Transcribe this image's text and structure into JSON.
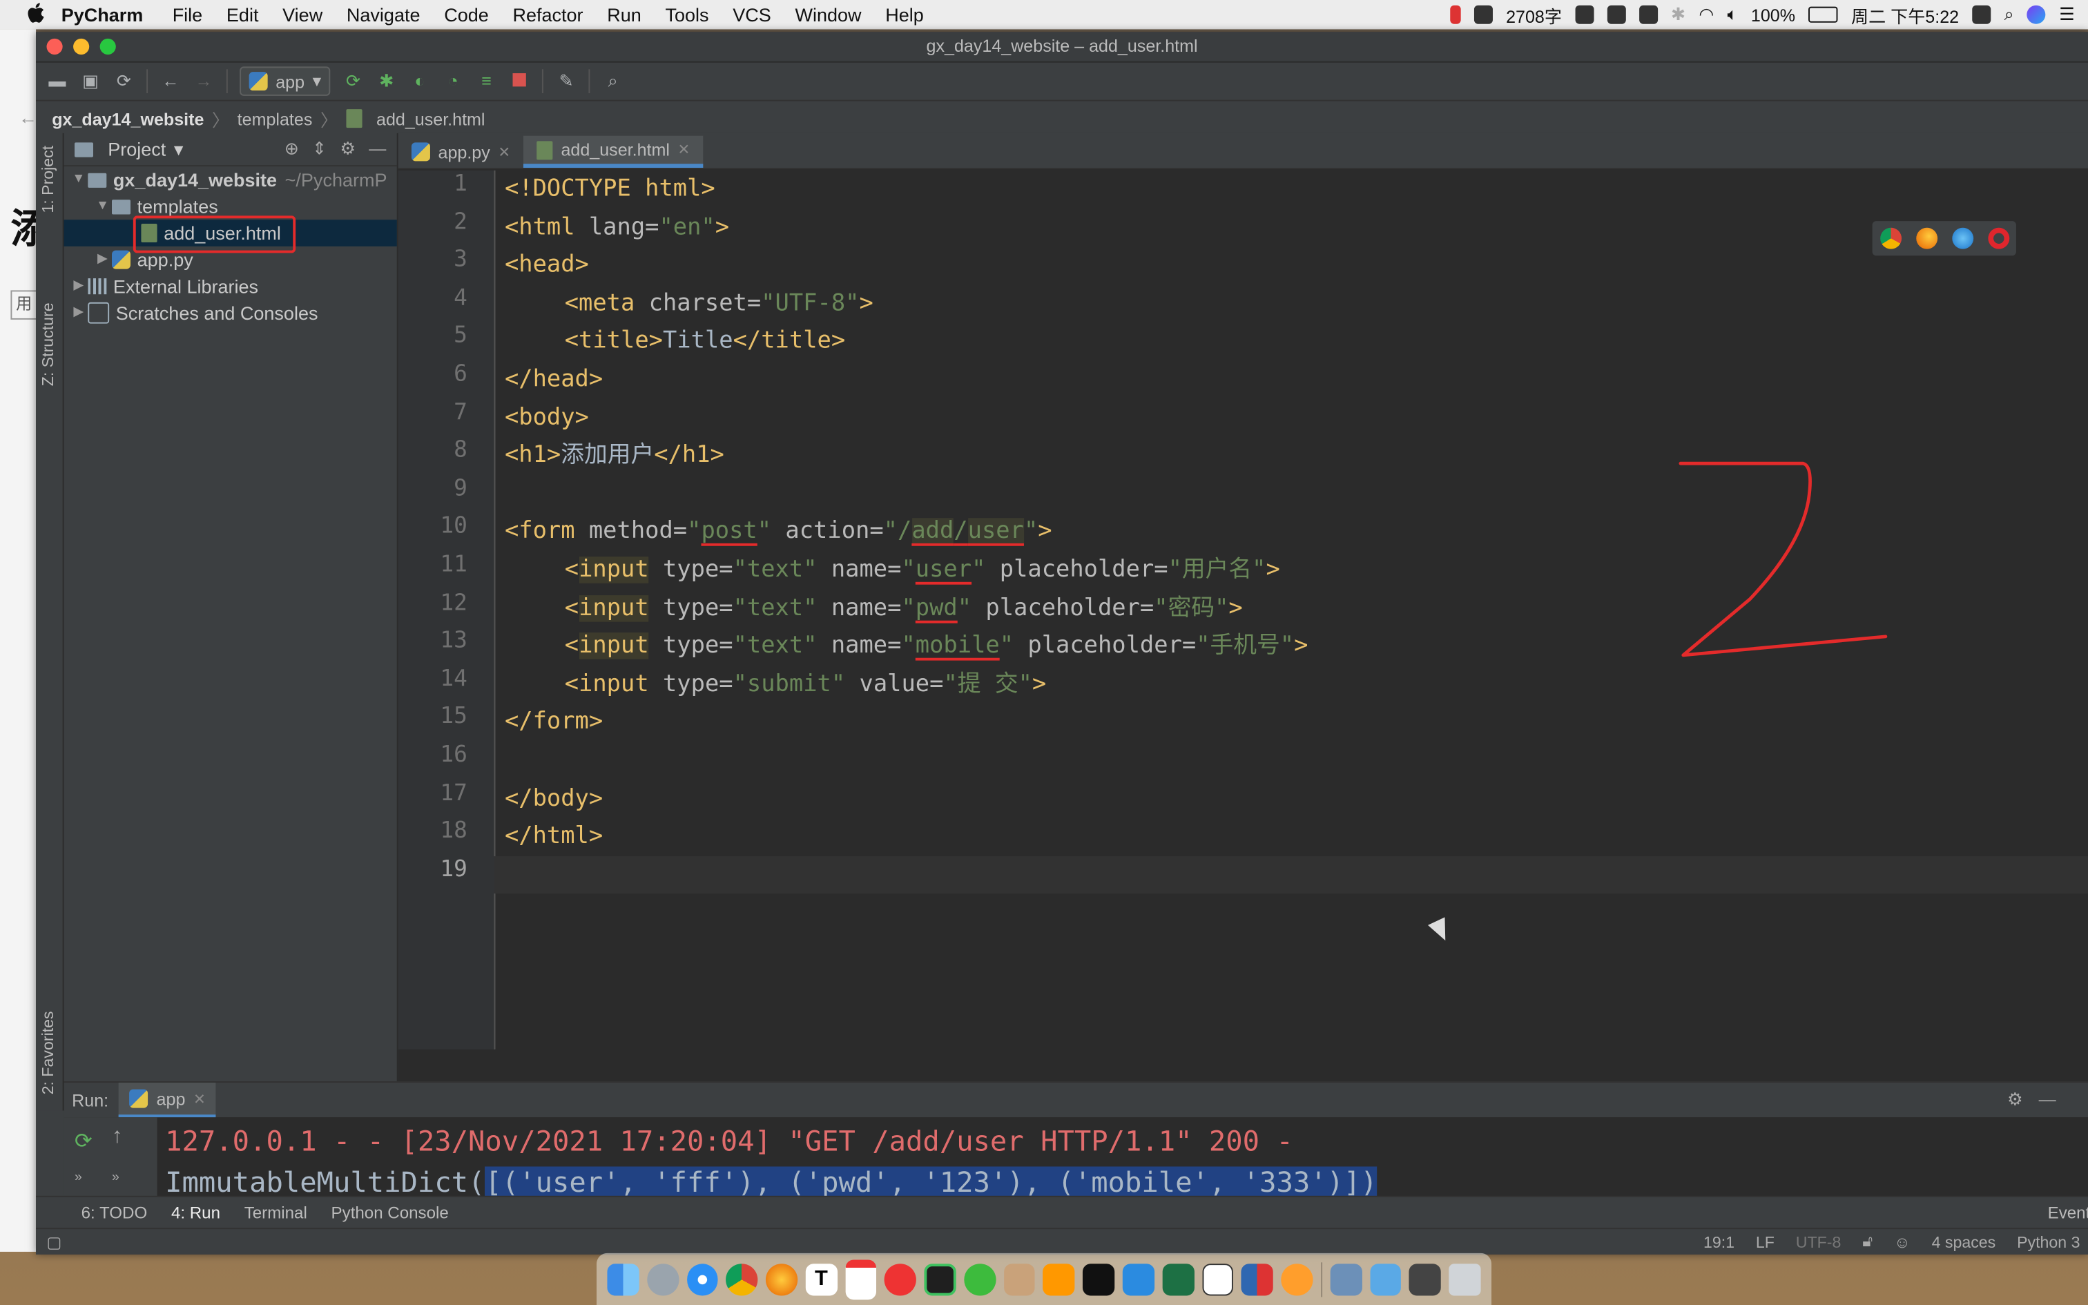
{
  "menubar": {
    "app_name": "PyCharm",
    "menus": [
      "File",
      "Edit",
      "View",
      "Navigate",
      "Code",
      "Refactor",
      "Run",
      "Tools",
      "VCS",
      "Window",
      "Help"
    ],
    "word_count": "2708字",
    "battery": "100%",
    "clock": "周二 下午5:22"
  },
  "background_window": {
    "big_char": "添",
    "small_char": "用"
  },
  "window": {
    "title": "gx_day14_website – add_user.html"
  },
  "toolbar": {
    "run_config": "app"
  },
  "breadcrumb": [
    "gx_day14_website",
    "templates",
    "add_user.html"
  ],
  "side_tabs": {
    "project": "1: Project",
    "structure": "Z: Structure",
    "favorites": "2: Favorites"
  },
  "project_panel": {
    "title": "Project",
    "root": "gx_day14_website",
    "root_path": "~/PycharmP",
    "folder_templates": "templates",
    "file_selected": "add_user.html",
    "file_app": "app.py",
    "external_libraries": "External Libraries",
    "scratches": "Scratches and Consoles"
  },
  "editor_tabs": [
    {
      "label": "app.py"
    },
    {
      "label": "add_user.html"
    }
  ],
  "code": {
    "line_numbers": [
      "1",
      "2",
      "3",
      "4",
      "5",
      "6",
      "7",
      "8",
      "9",
      "10",
      "11",
      "12",
      "13",
      "14",
      "15",
      "16",
      "17",
      "18",
      "19"
    ],
    "l1_doctype": "<!DOCTYPE html>",
    "l2_open": "<html ",
    "l2_attr": "lang=",
    "l2_val": "\"en\"",
    "l2_close": ">",
    "l3": "<head>",
    "l4_open": "<meta ",
    "l4_attr": "charset=",
    "l4_val": "\"UTF-8\"",
    "l4_close": ">",
    "l5_open": "<title>",
    "l5_text": "Title",
    "l5_close": "</title>",
    "l6": "</head>",
    "l7": "<body>",
    "l8_open": "<h1>",
    "l8_text": "添加用户",
    "l8_close": "</h1>",
    "l10_open": "<form ",
    "l10_attr1": "method=",
    "l10_q1": "\"",
    "l10_post": "post",
    "l10_q2": "\" ",
    "l10_attr2": "action=",
    "l10_path_a": "\"/",
    "l10_path_b": "add",
    "l10_path_c": "/",
    "l10_path_d": "user",
    "l10_path_e": "\"",
    "l10_close": ">",
    "input_tag_open": "<",
    "input_word": "input",
    "l11_rest_a": " type=",
    "l11_type": "\"text\"",
    "l11_rest_b": " name=",
    "l11_q": "\"",
    "l11_name": "user",
    "l11_q2": "\"",
    "l11_rest_c": " placeholder=",
    "l11_ph": "\"用户名\"",
    "l11_close": ">",
    "l12_rest_a": " type=",
    "l12_type": "\"text\"",
    "l12_rest_b": " name=",
    "l12_q": "\"",
    "l12_name": "pwd",
    "l12_q2": "\"",
    "l12_rest_c": " placeholder=",
    "l12_ph": "\"密码\"",
    "l12_close": ">",
    "l13_rest_a": " type=",
    "l13_type": "\"text\"",
    "l13_rest_b": " name=",
    "l13_q": "\"",
    "l13_name": "mobile",
    "l13_q2": "\"",
    "l13_rest_c": " placeholder=",
    "l13_ph": "\"手机号\"",
    "l13_close": ">",
    "l14_open": "<input ",
    "l14_attr1": "type=",
    "l14_val1": "\"submit\"",
    "l14_attr2": " value=",
    "l14_val2": "\"提 交\"",
    "l14_close": ">",
    "l15": "</form>",
    "l17": "</body>",
    "l18": "</html>"
  },
  "run_panel": {
    "label": "Run:",
    "config": "app",
    "log_line": "127.0.0.1 - - [23/Nov/2021 17:20:04] \"GET /add/user HTTP/1.1\" 200 -",
    "dict_prefix": "ImmutableMultiDict(",
    "dict_selected": "[('user', 'fff'), ('pwd', '123'), ('mobile', '333')])"
  },
  "bottom_tabs": {
    "todo": "6: TODO",
    "run": "4: Run",
    "terminal": "Terminal",
    "python_console": "Python Console",
    "event_log": "Event Log"
  },
  "status": {
    "position": "19:1",
    "line_sep": "LF",
    "encoding": "UTF-8",
    "indent": "4 spaces",
    "interpreter": "Python 3"
  },
  "colors": {
    "editor_bg": "#2b2b2b",
    "tag": "#e8bf6a",
    "string": "#6a8759",
    "annotation": "#e42b2b",
    "selection": "#214283"
  }
}
